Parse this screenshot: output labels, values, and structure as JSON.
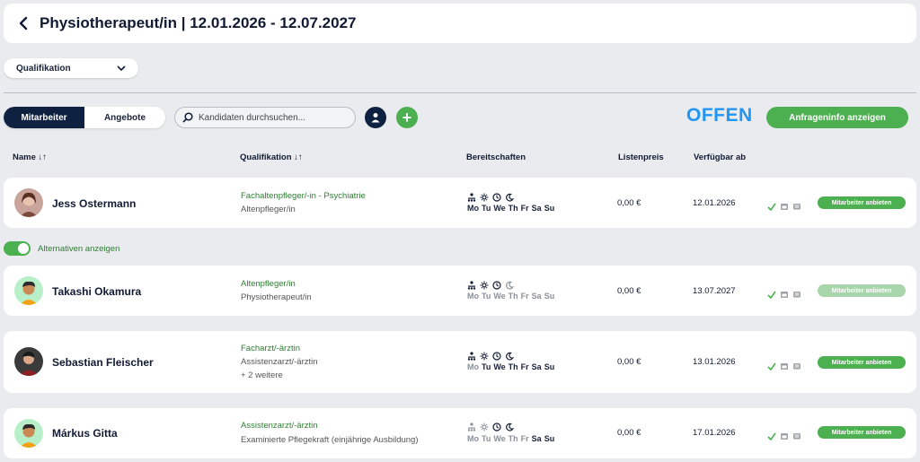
{
  "header": {
    "title": "Physiotherapeut/in | 12.01.2026 - 12.07.2027"
  },
  "filter": {
    "qualification_label": "Qualifikation"
  },
  "toolbar": {
    "tab_employees": "Mitarbeiter",
    "tab_offers": "Angebote",
    "search_placeholder": "Kandidaten durchsuchen...",
    "add": "+",
    "status": "OFFEN",
    "info_button": "Anfrageninfo anzeigen"
  },
  "columns": {
    "name": "Name ↓↑",
    "qualification": "Qualifikation ↓↑",
    "availability": "Bereitschaften",
    "price": "Listenpreis",
    "available_from": "Verfügbar ab"
  },
  "alternatives_label": "Alternativen anzeigen",
  "days": [
    "Mo",
    "Tu",
    "We",
    "Th",
    "Fr",
    "Sa",
    "Su"
  ],
  "offer_label": "Mitarbeiter anbieten",
  "rows": [
    {
      "name": "Jess Ostermann",
      "qual_main": "Fachaltenpfleger/-in - Psychiatrie",
      "qual_sub": "Altenpfleger/in",
      "qual_more": "",
      "price": "0,00 €",
      "date": "12.01.2026"
    },
    {
      "name": "Takashi Okamura",
      "qual_main": "Altenpfleger/in",
      "qual_sub": "Physiotherapeut/in",
      "qual_more": "",
      "price": "0,00 €",
      "date": "13.07.2027"
    },
    {
      "name": "Sebastian Fleischer",
      "qual_main": "Facharzt/-ärztin",
      "qual_sub": "Assistenzarzt/-ärztin",
      "qual_more": "+ 2 weitere",
      "price": "0,00 €",
      "date": "13.01.2026"
    },
    {
      "name": "Márkus Gitta",
      "qual_main": "Assistenzarzt/-ärztin",
      "qual_sub": "Examinierte Pflegekraft (einjährige Ausbildung)",
      "qual_more": "",
      "price": "0,00 €",
      "date": "17.01.2026"
    }
  ]
}
